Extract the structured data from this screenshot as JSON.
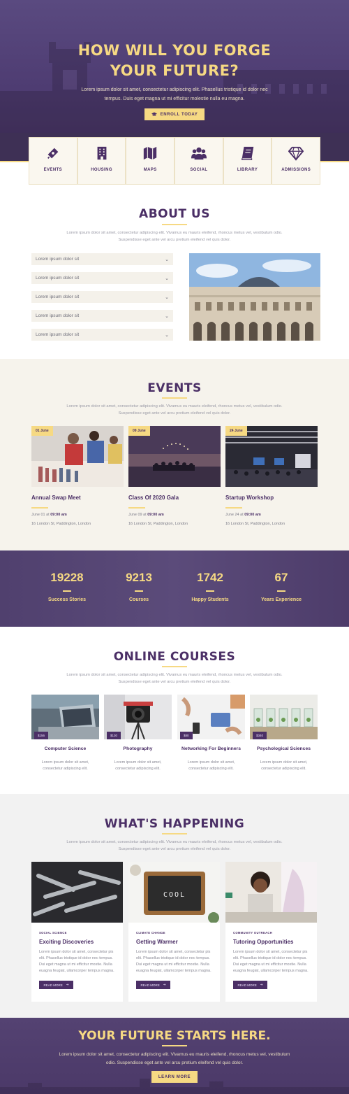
{
  "colors": {
    "purple": "#4b2f66",
    "gold": "#f6d983",
    "cream": "#f6f3ec"
  },
  "hero": {
    "title_line1": "HOW WILL YOU FORGE",
    "title_line2": "YOUR FUTURE?",
    "text": "Lorem ipsum dolor sit amet, consectetur adipiscing elit. Phasellus tristique id dolor nec tempus. Duis eget magna ut mi efficitur molestie nulla eu magna.",
    "button_label": "ENROLL TODAY",
    "button_icon": "graduation-cap-icon"
  },
  "quicknav": [
    {
      "label": "EVENTS",
      "icon": "ticket-icon"
    },
    {
      "label": "HOUSING",
      "icon": "building-icon"
    },
    {
      "label": "MAPS",
      "icon": "map-icon"
    },
    {
      "label": "SOCIAL",
      "icon": "users-icon"
    },
    {
      "label": "LIBRARY",
      "icon": "book-icon"
    },
    {
      "label": "ADMISSIONS",
      "icon": "diamond-icon"
    }
  ],
  "about": {
    "title": "ABOUT US",
    "text": "Lorem ipsum dolor sit amet, consectetur adipiscing elit. Vivamus eu mauris eleifend, rhoncus metus vel, vestibulum odio. Suspendisse eget ante vel arcu pretium eleifend vel quis dolor.",
    "accordion": [
      "Lorem ipsum dolor sit",
      "Lorem ipsum dolor sit",
      "Lorem ipsum dolor sit",
      "Lorem ipsum dolor sit",
      "Lorem ipsum dolor sit"
    ]
  },
  "events": {
    "title": "EVENTS",
    "text": "Lorem ipsum dolor sit amet, consectetur adipiscing elit. Vivamus eu mauris eleifend, rhoncus metus vel, vestibulum odio. Suspendisse eget ante vel arcu pretium eleifend vel quis dolor.",
    "items": [
      {
        "date_badge": "01 June",
        "title": "Annual Swap Meet",
        "when_prefix": "June 01 at ",
        "time": "09:00 am",
        "where": "16 London St, Paddington, London"
      },
      {
        "date_badge": "09 June",
        "title": "Class Of 2020 Gala",
        "when_prefix": "June 09 at ",
        "time": "09:00 am",
        "where": "16 London St, Paddington, London"
      },
      {
        "date_badge": "24 June",
        "title": "Startup Workshop",
        "when_prefix": "June 24 at ",
        "time": "09:00 am",
        "where": "16 London St, Paddington, London"
      }
    ]
  },
  "stats": [
    {
      "value": "19228",
      "label": "Success Stories"
    },
    {
      "value": "9213",
      "label": "Courses"
    },
    {
      "value": "1742",
      "label": "Happy Students"
    },
    {
      "value": "67",
      "label": "Years Experience"
    }
  ],
  "courses": {
    "title": "ONLINE COURSES",
    "text": "Lorem ipsum dolor sit amet, consectetur adipiscing elit. Vivamus eu mauris eleifend, rhoncus metus vel, vestibulum odio. Suspendisse eget ante vel arcu pretium eleifend vel quis dolor.",
    "items": [
      {
        "price": "$156",
        "title": "Computer Science",
        "desc": "Lorem ipsum dolor sit amet, consectetur adipiscing elit."
      },
      {
        "price": "$130",
        "title": "Photography",
        "desc": "Lorem ipsum dolor sit amet, consectetur adipiscing elit."
      },
      {
        "price": "$80",
        "title": "Networking For Beginners",
        "desc": "Lorem ipsum dolor sit amet, consectetur adipiscing elit."
      },
      {
        "price": "$340",
        "title": "Psychological Sciences",
        "desc": "Lorem ipsum dolor sit amet, consectetur adipiscing elit."
      }
    ]
  },
  "happening": {
    "title": "WHAT'S HAPPENING",
    "text": "Lorem ipsum dolor sit amet, consectetur adipiscing elit. Vivamus eu mauris eleifend, rhoncus metus vel, vestibulum odio. Suspendisse eget ante vel arcu pretium eleifend vel quis dolor.",
    "posts": [
      {
        "category": "SOCIAL SCIENCE",
        "title": "Exciting Discoveries",
        "text": "Lorem ipsum dolor sit amet, consectetur pis elit. Phasellus tristique id dolor nec tempus. Dui eget magna ut mi efficitur mostie. Nulla euagna feugiat, ullamcorper tempus magna.",
        "button": "READ MORE"
      },
      {
        "category": "CLIMATE CHANGE",
        "title": "Getting Warmer",
        "text": "Lorem ipsum dolor sit amet, consectetur pis elit. Phasellus tristique id dolor nec tempus. Dui eget magna ut mi efficitur mostie. Nulla euagna feugiat, ullamcorper tempus magna.",
        "button": "READ MORE",
        "image_text": "COOL"
      },
      {
        "category": "COMMUNITY OUTREACH",
        "title": "Tutoring Opportunities",
        "text": "Lorem ipsum dolor sit amet, consectetur pis elit. Phasellus tristique id dolor nec tempus. Dui eget magna ut mi efficitur mostie. Nulla euagna feugiat, ullamcorper tempus magna.",
        "button": "READ MORE"
      }
    ]
  },
  "cta": {
    "title": "YOUR FUTURE STARTS HERE.",
    "text": "Lorem ipsum dolor sit amet, consectetur adipiscing elit. Vivamus eu mauris eleifend, rhoncus metus vel, vestibulum odio. Suspendisse eget ante vel arcu pretium eleifend vel quis dolor.",
    "button_label": "LEARN MORE"
  }
}
